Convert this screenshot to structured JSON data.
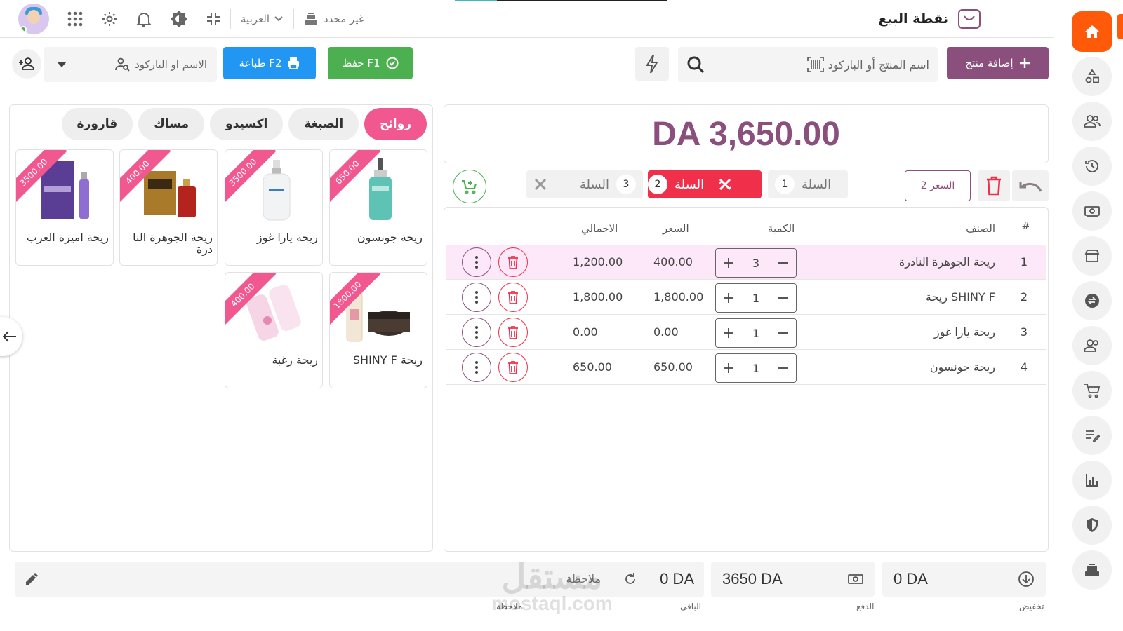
{
  "header": {
    "app_title": "نقطة البيع",
    "store": "غير محدد",
    "language": "العربية"
  },
  "nav": {
    "items": [
      "home-icon",
      "products-icon",
      "customers-icon",
      "history-icon",
      "cash-icon",
      "store-icon",
      "exchange-icon",
      "suppliers-icon",
      "cart-icon",
      "notes-icon",
      "reports-icon",
      "security-icon",
      "register-icon"
    ]
  },
  "toolbar": {
    "add_product": "إضافة منتج",
    "search_placeholder": "اسم المنتج أو الباركود",
    "save_label": "حفظ F1",
    "print_label": "طباعة F2",
    "customer_placeholder": "الاسم او الباركود"
  },
  "total": "DA 3,650.00",
  "carts": {
    "price_label": "السعر 2",
    "tabs": [
      {
        "label": "السلة",
        "num": "1",
        "active": false
      },
      {
        "label": "السلة",
        "num": "2",
        "active": true
      },
      {
        "label": "السلة",
        "num": "3",
        "active": false
      }
    ]
  },
  "table": {
    "headers": {
      "index": "#",
      "item": "الصنف",
      "qty": "الكمية",
      "price": "السعر",
      "total": "الاجمالي"
    },
    "rows": [
      {
        "index": "1",
        "item": "ريحة الجوهرة النادرة",
        "qty": "3",
        "price": "400.00",
        "total": "1,200.00"
      },
      {
        "index": "2",
        "item": "ريحة SHINY F",
        "qty": "1",
        "price": "1,800.00",
        "total": "1,800.00"
      },
      {
        "index": "3",
        "item": "ريحة يارا غوز",
        "qty": "1",
        "price": "0.00",
        "total": "0.00"
      },
      {
        "index": "4",
        "item": "ريحة جونسون",
        "qty": "1",
        "price": "650.00",
        "total": "650.00"
      }
    ]
  },
  "categories": [
    "روائح",
    "الصبغة",
    "اكسيدو",
    "مساك",
    "قارورة"
  ],
  "products": [
    {
      "name": "ريحة جونسون",
      "price": "650.00"
    },
    {
      "name": "ريحة يارا غوز",
      "price": "3500.00"
    },
    {
      "name": "ريحة الجوهرة النا درة",
      "price": "400.00"
    },
    {
      "name": "ريحة اميرة العرب",
      "price": "3500.00"
    },
    {
      "name": "ريحة SHINY F",
      "price": "1800.00"
    },
    {
      "name": "ريحة رغبة",
      "price": "400.00"
    }
  ],
  "footer": {
    "discount_value": "0 DA",
    "discount_label": "تخفيض",
    "paid_value": "3650 DA",
    "paid_label": "الدفع",
    "remaining_value": "0 DA",
    "remaining_label": "الباقي",
    "note_placeholder": "ملاحظة",
    "note_label": "ملاحظة"
  },
  "watermark": {
    "arabic": "مستقل",
    "latin": "mostaql.com"
  },
  "colors": {
    "brand": "#8a4f7d",
    "accent": "#ff5a0a",
    "danger": "#f0304a",
    "success": "#4caf50",
    "info": "#2196f3",
    "pink": "#f0588f"
  }
}
